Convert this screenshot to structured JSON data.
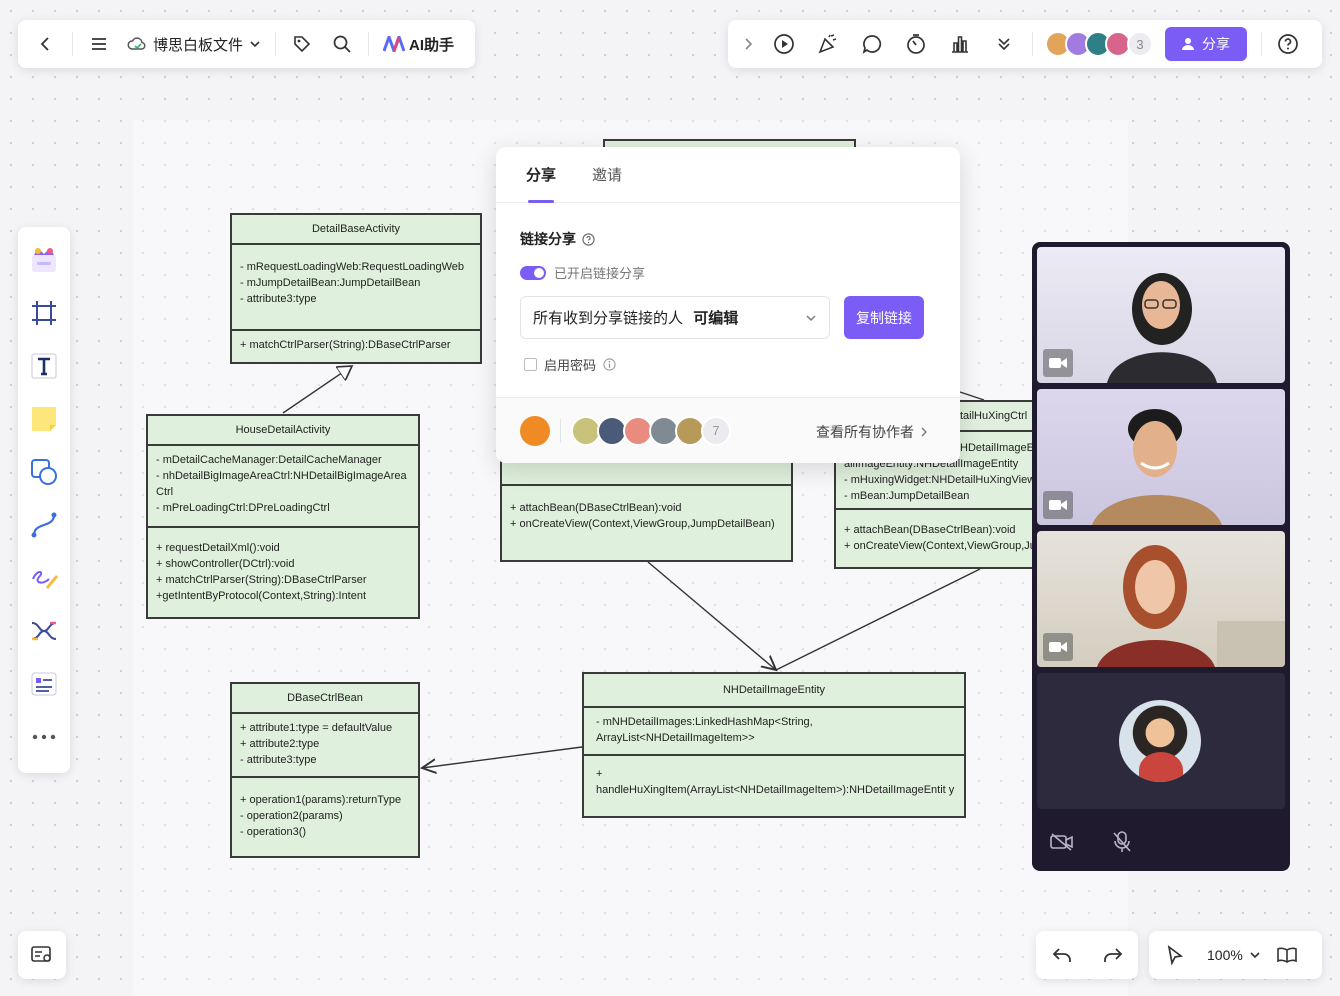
{
  "topbar": {
    "file_name": "博思白板文件",
    "ai_label": "AI助手",
    "collaborator_count": "3",
    "share_label": "分享"
  },
  "share_popup": {
    "tab_share": "分享",
    "tab_invite": "邀请",
    "section_title": "链接分享",
    "toggle_label": "已开启链接分享",
    "permission_prefix": "所有收到分享链接的人",
    "permission_value": "可编辑",
    "copy_link": "复制链接",
    "password_label": "启用密码",
    "collaborator_extra_count": "7",
    "view_all": "查看所有协作者"
  },
  "zoom": {
    "level": "100%"
  },
  "uml": {
    "detail_base": {
      "title": "DetailBaseActivity",
      "attrs": [
        "- mRequestLoadingWeb:RequestLoadingWeb",
        "- mJumpDetailBean:JumpDetailBean",
        "- attribute3:type"
      ],
      "ops": [
        "+ matchCtrlParser(String):DBaseCtrlParser"
      ]
    },
    "house_detail": {
      "title": "HouseDetailActivity",
      "attrs": [
        "- mDetailCacheManager:DetailCacheManager",
        "- nhDetailBigImageAreaCtrl:NHDetailBigImageArea Ctrl",
        "- mPreLoadingCtrl:DPreLoadingCtrl"
      ],
      "ops": [
        "+ requestDetailXml():void",
        "+ showController(DCtrl):void",
        "+ matchCtrlParser(String):DBaseCtrlParser",
        "+getIntentByProtocol(Context,String):Intent"
      ]
    },
    "dbase_ctrl": {
      "title": "DBaseCtrlBean",
      "attrs": [
        "+ attribute1:type = defaultValue",
        "+ attribute2:type",
        "- attribute3:type"
      ],
      "ops": [
        "+ operation1(params):returnType",
        "- operation2(params)",
        "- operation3()"
      ]
    },
    "middle": {
      "ops": [
        "+ attachBean(DBaseCtrlBean):void",
        "+ onCreateView(Context,ViewGroup,JumpDetailBean)"
      ]
    },
    "right": {
      "title_partial": "tailHuXingCtrl",
      "attrs": [
        "HDetailImageE",
        "allImageEntity:NHDetailImageEntity",
        "- mHuxingWidget:NHDetailHuXingView",
        "- mBean:JumpDetailBean"
      ],
      "ops": [
        "+ attachBean(DBaseCtrlBean):void",
        "+ onCreateView(Context,ViewGroup,Ju"
      ]
    },
    "nh_entity": {
      "title": "NHDetailImageEntity",
      "attrs": [
        "- mNHDetailImages:LinkedHashMap<String, ArrayList<NHDetailImageItem>>"
      ],
      "ops": [
        "+",
        "handleHuXingItem(ArrayList<NHDetailImageItem>):NHDetailImageEntit y"
      ]
    }
  },
  "colors": {
    "accent": "#7b5cf5",
    "uml_fill": "#dff0dc",
    "video_panel_bg": "#1f1a2e"
  }
}
